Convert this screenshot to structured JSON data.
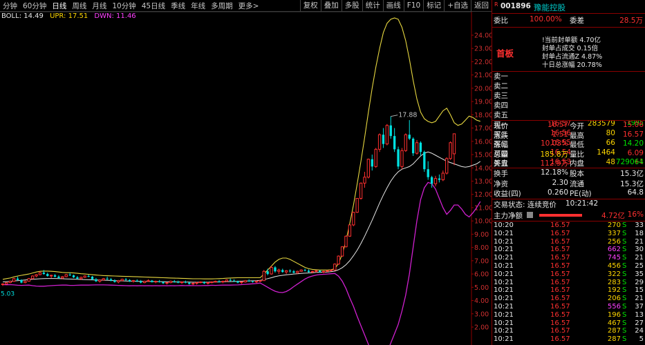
{
  "toolbar": {
    "tabs": [
      "分钟",
      "60分钟",
      "日线",
      "周线",
      "月线",
      "10分钟",
      "45日线",
      "季线",
      "年线",
      "多周期",
      "更多>"
    ],
    "active_tab": "日线",
    "right_buttons": [
      "复权",
      "叠加",
      "多股",
      "统计",
      "画线",
      "F10",
      "标记",
      "+自选",
      "返回"
    ]
  },
  "indicator": {
    "boll": "BOLL: 14.49",
    "upr": "UPR: 17.51",
    "dwn": "DWN: 11.46"
  },
  "axis": {
    "ticks": [
      "24.00",
      "23.00",
      "22.00",
      "21.00",
      "20.00",
      "19.00",
      "18.00",
      "17.00",
      "16.00",
      "15.00",
      "14.00",
      "13.00",
      "12.00",
      "11.00",
      "10.00",
      "9.00",
      "8.00",
      "7.00",
      "6.00",
      "5.00",
      "4.00",
      "3.00",
      "2.00"
    ],
    "peak_label": "17.88",
    "left_value": "5.03"
  },
  "chart_data": {
    "type": "candlestick",
    "ylim": [
      2.0,
      24.0
    ],
    "candles": [
      [
        5.2,
        5.3,
        5.1,
        5.25
      ],
      [
        5.25,
        5.4,
        5.2,
        5.35
      ],
      [
        5.35,
        5.5,
        5.3,
        5.45
      ],
      [
        5.45,
        5.7,
        5.4,
        5.65
      ],
      [
        5.65,
        5.8,
        5.5,
        5.55
      ],
      [
        5.55,
        5.6,
        5.3,
        5.35
      ],
      [
        5.35,
        5.5,
        5.3,
        5.45
      ],
      [
        5.45,
        5.7,
        5.45,
        5.65
      ],
      [
        5.65,
        5.9,
        5.6,
        5.85
      ],
      [
        5.85,
        6.0,
        5.75,
        5.95
      ],
      [
        5.95,
        6.2,
        5.9,
        6.1
      ],
      [
        6.1,
        6.3,
        5.95,
        6.0
      ],
      [
        6.0,
        6.1,
        5.8,
        5.85
      ],
      [
        5.85,
        5.95,
        5.7,
        5.9
      ],
      [
        5.9,
        6.0,
        5.75,
        5.8
      ],
      [
        5.8,
        5.9,
        5.65,
        5.7
      ],
      [
        5.7,
        5.85,
        5.6,
        5.8
      ],
      [
        5.8,
        6.0,
        5.75,
        5.95
      ],
      [
        5.95,
        6.1,
        5.85,
        5.9
      ],
      [
        5.9,
        5.95,
        5.7,
        5.75
      ],
      [
        5.75,
        5.85,
        5.6,
        5.65
      ],
      [
        5.65,
        5.8,
        5.55,
        5.75
      ],
      [
        5.75,
        5.9,
        5.7,
        5.85
      ],
      [
        5.85,
        5.95,
        5.75,
        5.8
      ],
      [
        5.8,
        5.85,
        5.55,
        5.6
      ],
      [
        5.6,
        5.7,
        5.4,
        5.45
      ],
      [
        5.45,
        5.6,
        5.35,
        5.55
      ],
      [
        5.55,
        5.7,
        5.5,
        5.65
      ],
      [
        5.65,
        5.8,
        5.55,
        5.6
      ],
      [
        5.6,
        5.7,
        5.45,
        5.5
      ],
      [
        5.5,
        5.6,
        5.35,
        5.4
      ],
      [
        5.4,
        5.55,
        5.3,
        5.5
      ],
      [
        5.5,
        5.65,
        5.45,
        5.6
      ],
      [
        5.6,
        5.7,
        5.5,
        5.55
      ],
      [
        5.55,
        5.6,
        5.4,
        5.45
      ],
      [
        5.45,
        5.55,
        5.35,
        5.5
      ],
      [
        5.5,
        5.6,
        5.4,
        5.45
      ],
      [
        5.45,
        5.55,
        5.3,
        5.35
      ],
      [
        5.35,
        5.5,
        5.3,
        5.45
      ],
      [
        5.45,
        5.6,
        5.4,
        5.5
      ],
      [
        5.5,
        5.55,
        5.35,
        5.4
      ],
      [
        5.4,
        5.5,
        5.3,
        5.45
      ],
      [
        5.45,
        5.55,
        5.35,
        5.4
      ],
      [
        5.4,
        5.45,
        5.25,
        5.3
      ],
      [
        5.3,
        5.4,
        5.2,
        5.35
      ],
      [
        5.35,
        5.5,
        5.3,
        5.45
      ],
      [
        5.45,
        5.55,
        5.35,
        5.4
      ],
      [
        5.4,
        5.5,
        5.3,
        5.35
      ],
      [
        5.35,
        5.45,
        5.25,
        5.4
      ],
      [
        5.4,
        5.5,
        5.3,
        5.35
      ],
      [
        5.35,
        5.4,
        5.2,
        5.25
      ],
      [
        5.25,
        5.35,
        5.15,
        5.3
      ],
      [
        5.3,
        5.4,
        5.2,
        5.35
      ],
      [
        5.35,
        5.45,
        5.3,
        5.4
      ],
      [
        5.4,
        5.45,
        5.25,
        5.3
      ],
      [
        5.3,
        5.4,
        5.2,
        5.35
      ],
      [
        5.35,
        5.45,
        5.3,
        5.4
      ],
      [
        5.4,
        5.5,
        5.35,
        5.45
      ],
      [
        5.45,
        5.55,
        5.35,
        5.4
      ],
      [
        5.4,
        5.5,
        5.3,
        5.45
      ],
      [
        5.45,
        5.6,
        5.4,
        5.55
      ],
      [
        5.55,
        5.65,
        5.45,
        5.5
      ],
      [
        5.5,
        5.6,
        5.4,
        5.45
      ],
      [
        5.45,
        5.5,
        5.3,
        5.35
      ],
      [
        5.35,
        5.45,
        5.25,
        5.4
      ],
      [
        5.4,
        5.55,
        5.35,
        5.5
      ],
      [
        5.5,
        5.6,
        5.4,
        5.45
      ],
      [
        5.45,
        5.5,
        5.35,
        5.4
      ],
      [
        5.4,
        5.5,
        5.3,
        5.45
      ],
      [
        5.45,
        5.55,
        5.4,
        5.5
      ],
      [
        5.5,
        6.3,
        5.5,
        6.2
      ],
      [
        6.2,
        6.4,
        5.9,
        6.0
      ],
      [
        6.0,
        6.6,
        5.95,
        6.5
      ],
      [
        6.5,
        6.6,
        6.1,
        6.2
      ],
      [
        6.2,
        6.4,
        6.0,
        6.3
      ],
      [
        6.3,
        6.4,
        6.1,
        6.15
      ],
      [
        6.15,
        6.3,
        6.0,
        6.25
      ],
      [
        6.25,
        6.35,
        6.1,
        6.2
      ],
      [
        6.2,
        6.3,
        6.05,
        6.1
      ],
      [
        6.1,
        6.25,
        6.0,
        6.2
      ],
      [
        6.2,
        6.35,
        6.15,
        6.3
      ],
      [
        6.3,
        6.4,
        6.2,
        6.25
      ],
      [
        6.25,
        6.35,
        6.1,
        6.15
      ],
      [
        6.15,
        6.25,
        6.05,
        6.2
      ],
      [
        6.2,
        6.3,
        6.1,
        6.25
      ],
      [
        6.25,
        6.3,
        6.1,
        6.15
      ],
      [
        6.15,
        6.25,
        6.05,
        6.2
      ],
      [
        6.2,
        6.3,
        6.15,
        6.25
      ],
      [
        6.25,
        6.35,
        6.2,
        6.3
      ],
      [
        6.3,
        6.8,
        6.25,
        6.75
      ],
      [
        6.75,
        7.4,
        6.7,
        7.35
      ],
      [
        7.35,
        8.1,
        7.3,
        8.05
      ],
      [
        8.05,
        8.9,
        8.0,
        8.85
      ],
      [
        8.85,
        9.7,
        8.8,
        9.7
      ],
      [
        9.7,
        10.7,
        9.6,
        10.65
      ],
      [
        10.65,
        11.7,
        10.6,
        11.7
      ],
      [
        11.7,
        12.9,
        11.6,
        12.85
      ],
      [
        12.85,
        13.7,
        12.5,
        13.3
      ],
      [
        13.3,
        14.7,
        13.2,
        14.65
      ],
      [
        14.65,
        15.0,
        13.8,
        14.1
      ],
      [
        14.1,
        15.5,
        14.0,
        15.4
      ],
      [
        15.4,
        16.6,
        15.2,
        16.5
      ],
      [
        16.5,
        17.0,
        15.5,
        15.8
      ],
      [
        15.8,
        17.3,
        15.7,
        17.2
      ],
      [
        17.2,
        17.88,
        16.2,
        16.4
      ],
      [
        16.4,
        17.0,
        15.2,
        15.4
      ],
      [
        15.4,
        15.6,
        13.9,
        14.1
      ],
      [
        14.1,
        15.5,
        13.9,
        15.3
      ],
      [
        15.3,
        16.6,
        15.2,
        16.5
      ],
      [
        16.5,
        17.6,
        16.1,
        16.2
      ],
      [
        16.2,
        16.3,
        14.9,
        15.1
      ],
      [
        15.1,
        16.1,
        15.0,
        15.9
      ],
      [
        15.9,
        16.0,
        14.9,
        15.2
      ],
      [
        15.2,
        15.3,
        13.7,
        13.9
      ],
      [
        13.9,
        14.5,
        13.1,
        13.3
      ],
      [
        13.3,
        13.4,
        12.5,
        12.8
      ],
      [
        12.8,
        13.4,
        12.6,
        13.2
      ],
      [
        13.2,
        13.5,
        12.9,
        13.1
      ],
      [
        13.1,
        13.8,
        13.0,
        13.6
      ],
      [
        13.6,
        14.8,
        13.5,
        14.7
      ],
      [
        14.7,
        16.0,
        14.6,
        15.9
      ],
      [
        15.06,
        16.57,
        14.2,
        16.57
      ]
    ],
    "upper": [
      5.6,
      5.65,
      5.7,
      5.78,
      5.85,
      5.9,
      5.95,
      6.0,
      6.08,
      6.15,
      6.2,
      6.22,
      6.22,
      6.2,
      6.18,
      6.15,
      6.12,
      6.1,
      6.1,
      6.08,
      6.05,
      6.02,
      6.0,
      5.98,
      5.95,
      5.92,
      5.9,
      5.88,
      5.87,
      5.86,
      5.85,
      5.84,
      5.83,
      5.82,
      5.81,
      5.8,
      5.79,
      5.78,
      5.77,
      5.76,
      5.75,
      5.74,
      5.73,
      5.72,
      5.71,
      5.7,
      5.69,
      5.68,
      5.67,
      5.66,
      5.65,
      5.64,
      5.64,
      5.64,
      5.63,
      5.63,
      5.63,
      5.64,
      5.65,
      5.66,
      5.68,
      5.7,
      5.71,
      5.72,
      5.72,
      5.72,
      5.72,
      5.72,
      5.72,
      5.72,
      6.0,
      6.3,
      6.6,
      6.9,
      7.1,
      7.2,
      7.2,
      7.1,
      6.95,
      6.8,
      6.65,
      6.5,
      6.4,
      6.35,
      6.32,
      6.3,
      6.3,
      6.3,
      6.32,
      6.4,
      6.8,
      7.5,
      8.5,
      9.8,
      11.2,
      12.8,
      14.5,
      16.3,
      18.2,
      20.0,
      21.6,
      23.0,
      24.2,
      24.9,
      25.2,
      25.3,
      25.2,
      24.6,
      23.6,
      22.2,
      20.6,
      19.2,
      18.2,
      17.7,
      17.5,
      17.4,
      17.5,
      17.9,
      18.3,
      18.5,
      18.0,
      17.4,
      17.2,
      17.3,
      17.6,
      17.9,
      17.8,
      17.6,
      17.51
    ],
    "mid": [
      5.4,
      5.42,
      5.45,
      5.48,
      5.5,
      5.52,
      5.55,
      5.58,
      5.6,
      5.62,
      5.64,
      5.65,
      5.66,
      5.66,
      5.66,
      5.65,
      5.64,
      5.63,
      5.62,
      5.61,
      5.6,
      5.59,
      5.58,
      5.57,
      5.56,
      5.55,
      5.54,
      5.53,
      5.52,
      5.51,
      5.5,
      5.49,
      5.48,
      5.47,
      5.46,
      5.46,
      5.45,
      5.45,
      5.44,
      5.44,
      5.43,
      5.43,
      5.42,
      5.42,
      5.41,
      5.41,
      5.4,
      5.4,
      5.4,
      5.39,
      5.39,
      5.38,
      5.38,
      5.38,
      5.38,
      5.38,
      5.39,
      5.39,
      5.4,
      5.41,
      5.42,
      5.43,
      5.44,
      5.45,
      5.46,
      5.47,
      5.48,
      5.49,
      5.5,
      5.52,
      5.58,
      5.65,
      5.72,
      5.8,
      5.86,
      5.9,
      5.94,
      5.97,
      6.0,
      6.02,
      6.04,
      6.06,
      6.08,
      6.1,
      6.12,
      6.13,
      6.14,
      6.15,
      6.17,
      6.22,
      6.32,
      6.48,
      6.7,
      7.0,
      7.38,
      7.8,
      8.3,
      8.85,
      9.45,
      10.05,
      10.7,
      11.35,
      11.95,
      12.5,
      13.0,
      13.4,
      13.7,
      13.9,
      14.0,
      14.1,
      14.3,
      14.6,
      14.9,
      15.1,
      15.2,
      15.1,
      14.95,
      14.8,
      14.65,
      14.5,
      14.4,
      14.3,
      14.2,
      14.1,
      14.05,
      14.1,
      14.2,
      14.3,
      14.49
    ],
    "lower": [
      5.2,
      5.19,
      5.2,
      5.18,
      5.15,
      5.14,
      5.15,
      5.16,
      5.12,
      5.09,
      5.08,
      5.08,
      5.1,
      5.12,
      5.14,
      5.15,
      5.16,
      5.16,
      5.14,
      5.14,
      5.15,
      5.16,
      5.16,
      5.16,
      5.17,
      5.18,
      5.18,
      5.18,
      5.17,
      5.16,
      5.15,
      5.14,
      5.13,
      5.12,
      5.11,
      5.12,
      5.11,
      5.12,
      5.11,
      5.12,
      5.11,
      5.12,
      5.11,
      5.12,
      5.11,
      5.12,
      5.11,
      5.12,
      5.13,
      5.12,
      5.13,
      5.12,
      5.12,
      5.12,
      5.13,
      5.13,
      5.15,
      5.14,
      5.15,
      5.16,
      5.16,
      5.16,
      5.17,
      5.18,
      5.2,
      5.22,
      5.24,
      5.26,
      5.28,
      5.32,
      5.16,
      5.0,
      4.84,
      4.7,
      4.62,
      4.6,
      4.68,
      4.84,
      5.05,
      5.24,
      5.43,
      5.62,
      5.76,
      5.85,
      5.92,
      5.96,
      5.98,
      6.0,
      6.02,
      6.04,
      5.84,
      5.46,
      4.9,
      4.2,
      3.56,
      2.8,
      2.1,
      1.4,
      0.7,
      0.1,
      -0.2,
      -0.3,
      -0.3,
      0.1,
      0.8,
      1.5,
      2.2,
      3.2,
      4.4,
      6.0,
      8.0,
      10.0,
      11.6,
      12.5,
      12.9,
      12.8,
      12.4,
      11.7,
      11.0,
      10.5,
      10.8,
      11.2,
      11.2,
      10.9,
      10.5,
      10.3,
      10.6,
      11.0,
      11.46
    ]
  },
  "panel": {
    "code": "001896",
    "name": "豫能控股",
    "weibi_label": "委比",
    "weibi_value": "100.00%",
    "weicha_label": "委差",
    "weicha_value": "28.5万",
    "shouban": "首板",
    "seal_info": [
      "!当前封单额 4.70亿",
      "封单占成交 0.15倍",
      "封单占流通Z 4.87%",
      "十日总涨幅 20.78%"
    ],
    "order_book": [
      {
        "label": "卖一",
        "price": "",
        "vol": "",
        "chg": ""
      },
      {
        "label": "卖二",
        "price": "",
        "vol": "",
        "chg": ""
      },
      {
        "label": "卖三",
        "price": "",
        "vol": "",
        "chg": ""
      },
      {
        "label": "卖四",
        "price": "",
        "vol": "",
        "chg": ""
      },
      {
        "label": "卖五",
        "price": "",
        "vol": "",
        "chg": ""
      },
      {
        "label": "买一",
        "price": "16.57",
        "vol": "283579",
        "chg": "-1995"
      },
      {
        "label": "买二",
        "price": "16.56",
        "vol": "80",
        "chg": ""
      },
      {
        "label": "买三",
        "price": "16.55",
        "vol": "66",
        "chg": ""
      },
      {
        "label": "买四",
        "price": "16.54",
        "vol": "1464",
        "chg": ""
      },
      {
        "label": "买五",
        "price": "16.53",
        "vol": "48",
        "chg": "+1"
      }
    ],
    "quote": [
      {
        "l1": "现价",
        "v1": "16.57",
        "l2": "今开",
        "v2": "15.06"
      },
      {
        "l1": "涨跌",
        "v1": "1.51",
        "l2": "最高",
        "v2": "16.57"
      },
      {
        "l1": "涨幅",
        "v1": "10.03%",
        "l2": "最低",
        "v2": "14.20"
      },
      {
        "l1": "总量",
        "v1": "185.8万",
        "l2": "量比",
        "v2": "6.09"
      },
      {
        "l1": "外盘",
        "v1": "112.9万",
        "l2": "内盘",
        "v2": "729064"
      }
    ],
    "stats": [
      {
        "l1": "换手",
        "v1": "12.18%",
        "l2": "股本",
        "v2": "15.3亿"
      },
      {
        "l1": "净资",
        "v1": "2.30",
        "l2": "流通",
        "v2": "15.3亿"
      },
      {
        "l1": "收益(四)",
        "v1": "0.260",
        "l2": "PE(动)",
        "v2": "64.8"
      }
    ],
    "status_label": "交易状态: 连续竞价",
    "status_time": "10:21:42",
    "main_flow_label": "主力净额",
    "main_flow_value": "4.72亿",
    "main_flow_pct": "16%",
    "ticks": [
      {
        "t": "10:20",
        "p": "16.57",
        "v": "270",
        "s": "S",
        "n": "33"
      },
      {
        "t": "10:21",
        "p": "16.57",
        "v": "337",
        "s": "S",
        "n": "18"
      },
      {
        "t": "10:21",
        "p": "16.57",
        "v": "256",
        "s": "S",
        "n": "21"
      },
      {
        "t": "10:21",
        "p": "16.57",
        "v": "662",
        "s": "S",
        "n": "30"
      },
      {
        "t": "10:21",
        "p": "16.57",
        "v": "745",
        "s": "S",
        "n": "21"
      },
      {
        "t": "10:21",
        "p": "16.57",
        "v": "456",
        "s": "S",
        "n": "25"
      },
      {
        "t": "10:21",
        "p": "16.57",
        "v": "322",
        "s": "S",
        "n": "35"
      },
      {
        "t": "10:21",
        "p": "16.57",
        "v": "283",
        "s": "S",
        "n": "29"
      },
      {
        "t": "10:21",
        "p": "16.57",
        "v": "192",
        "s": "S",
        "n": "15"
      },
      {
        "t": "10:21",
        "p": "16.57",
        "v": "206",
        "s": "S",
        "n": "21"
      },
      {
        "t": "10:21",
        "p": "16.57",
        "v": "556",
        "s": "S",
        "n": "37"
      },
      {
        "t": "10:21",
        "p": "16.57",
        "v": "196",
        "s": "S",
        "n": "13"
      },
      {
        "t": "10:21",
        "p": "16.57",
        "v": "467",
        "s": "S",
        "n": "27"
      },
      {
        "t": "10:21",
        "p": "16.57",
        "v": "287",
        "s": "S",
        "n": "24"
      },
      {
        "t": "10:21",
        "p": "16.57",
        "v": "287",
        "s": "S",
        "n": "5"
      }
    ]
  }
}
